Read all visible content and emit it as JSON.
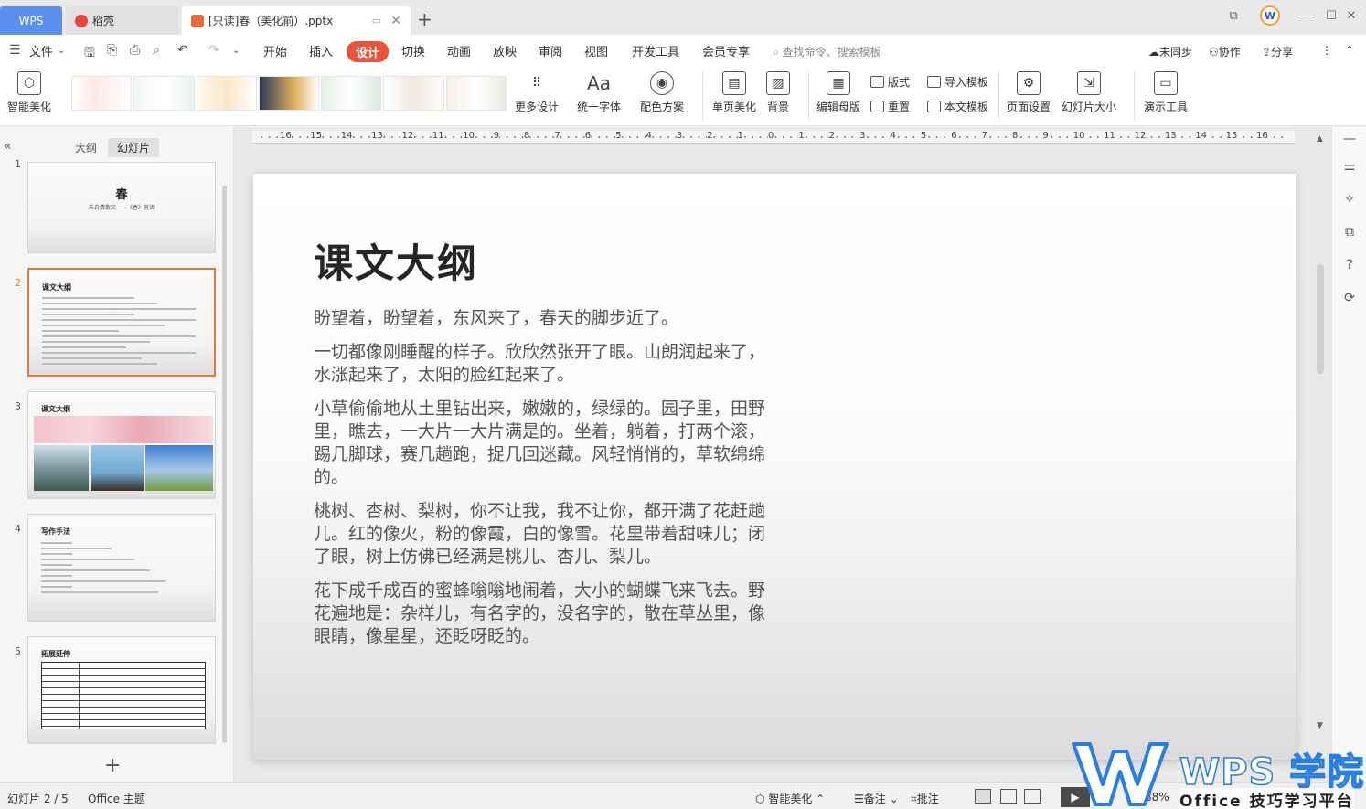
{
  "titlebar": {
    "wps_tab": "WPS",
    "tabs": [
      {
        "label": "稻壳"
      },
      {
        "label": "[只读]春（美化前）.pptx"
      }
    ]
  },
  "menu": {
    "file": "文件",
    "items": [
      "开始",
      "插入",
      "设计",
      "切换",
      "动画",
      "放映",
      "审阅",
      "视图",
      "开发工具",
      "会员专享"
    ],
    "active": "设计",
    "search_placeholder": "查找命令、搜索模板",
    "unsynced": "未同步",
    "collab": "协作",
    "share": "分享"
  },
  "ribbon": {
    "smart_beautify": "智能美化",
    "more_design": "更多设计",
    "unify_font": "统一字体",
    "color_scheme": "配色方案",
    "single_page_beautify": "单页美化",
    "background": "背景",
    "edit_master": "编辑母版",
    "layout": "版式",
    "reset": "重置",
    "import_template": "导入模板",
    "this_template": "本文模板",
    "page_setup": "页面设置",
    "slide_size": "幻灯片大小",
    "presenter_tools": "演示工具"
  },
  "left_panel": {
    "tab_outline": "大纲",
    "tab_slides": "幻灯片",
    "slides": [
      {
        "num": "1",
        "title": "春",
        "subtitle": "朱自清散文——《春》赏读"
      },
      {
        "num": "2",
        "title": "课文大纲"
      },
      {
        "num": "3",
        "title": "课文大纲"
      },
      {
        "num": "4",
        "title": "写作手法"
      },
      {
        "num": "5",
        "title": "拓展延伸"
      }
    ]
  },
  "ruler": {
    "labels": [
      "16",
      "15",
      "14",
      "13",
      "12",
      "11",
      "10",
      "9",
      "8",
      "7",
      "6",
      "5",
      "4",
      "3",
      "2",
      "1",
      "0",
      "1",
      "2",
      "3",
      "4",
      "5",
      "6",
      "7",
      "8",
      "9",
      "10",
      "11",
      "12",
      "13",
      "14",
      "15",
      "16"
    ]
  },
  "slide": {
    "title": "课文大纲",
    "paragraphs": [
      "盼望着，盼望着，东风来了，春天的脚步近了。",
      "一切都像刚睡醒的样子。欣欣然张开了眼。山朗润起来了，水涨起来了，太阳的脸红起来了。",
      "小草偷偷地从土里钻出来，嫩嫩的，绿绿的。园子里，田野里，瞧去，一大片一大片满是的。坐着，躺着，打两个滚，踢几脚球，赛几趟跑，捉几回迷藏。风轻悄悄的，草软绵绵的。",
      "桃树、杏树、梨树，你不让我，我不让你，都开满了花赶趟儿。红的像火，粉的像霞，白的像雪。花里带着甜味儿；闭了眼，树上仿佛已经满是桃儿、杏儿、梨儿。",
      "花下成千成百的蜜蜂嗡嗡地闹着，大小的蝴蝶飞来飞去。野花遍地是：杂样儿，有名字的，没名字的，散在草丛里，像眼睛，像星星，还眨呀眨的。"
    ]
  },
  "status": {
    "slide_pos": "幻灯片 2 / 5",
    "theme": "Office 主题",
    "smart": "智能美化",
    "notes": "备注",
    "comment": "批注",
    "zoom": "88%"
  },
  "watermark": {
    "brand": "WPS 学院",
    "tagline": "Office 技巧学习平台"
  },
  "colors": {
    "accent": "#e8543a",
    "wps_blue": "#5b8ff0",
    "selected_border": "#e07a3b"
  }
}
